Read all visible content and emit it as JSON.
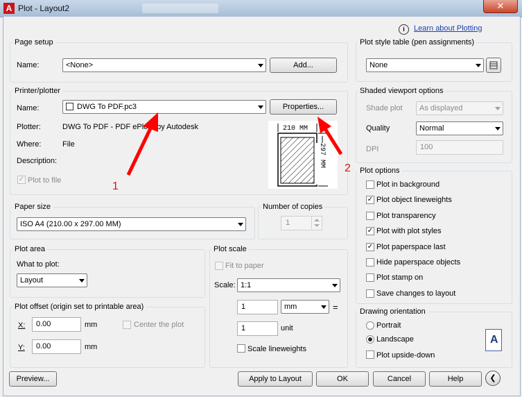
{
  "window": {
    "title": "Plot - Layout2",
    "close_glyph": "✕",
    "app_icon_letter": "A"
  },
  "help_link": {
    "label": "Learn about Plotting",
    "icon": "info-icon"
  },
  "page_setup": {
    "title": "Page setup",
    "name_label": "Name:",
    "name_value": "<None>",
    "add_button": "Add..."
  },
  "printer": {
    "title": "Printer/plotter",
    "name_label": "Name:",
    "name_value": "DWG To PDF.pc3",
    "properties_button": "Properties...",
    "plotter_label": "Plotter:",
    "plotter_value": "DWG To PDF - PDF ePlot - by Autodesk",
    "where_label": "Where:",
    "where_value": "File",
    "description_label": "Description:",
    "plot_to_file_label": "Plot to file",
    "plot_to_file_checked": true,
    "preview_width": "210 MM",
    "preview_height": "297 MM"
  },
  "annotations": {
    "arrow_1_label": "1",
    "arrow_2_label": "2",
    "arrow_color": "#ff0000"
  },
  "paper_size": {
    "title": "Paper size",
    "value": "ISO A4 (210.00 x 297.00 MM)"
  },
  "copies": {
    "title": "Number of copies",
    "value": "1"
  },
  "plot_area": {
    "title": "Plot area",
    "what_label": "What to plot:",
    "what_value": "Layout"
  },
  "plot_offset": {
    "title": "Plot offset (origin set to printable area)",
    "x_label": "X:",
    "x_value": "0.00",
    "x_unit": "mm",
    "y_label": "Y:",
    "y_value": "0.00",
    "y_unit": "mm",
    "center_label": "Center the plot"
  },
  "plot_scale": {
    "title": "Plot scale",
    "fit_label": "Fit to paper",
    "scale_label": "Scale:",
    "scale_value": "1:1",
    "value1": "1",
    "unit1": "mm",
    "equals": "=",
    "value2": "1",
    "unit2": "unit",
    "lineweights_label": "Scale lineweights"
  },
  "plot_style_table": {
    "title": "Plot style table (pen assignments)",
    "value": "None"
  },
  "shaded_viewport": {
    "title": "Shaded viewport options",
    "shade_label": "Shade plot",
    "shade_value": "As displayed",
    "quality_label": "Quality",
    "quality_value": "Normal",
    "dpi_label": "DPI",
    "dpi_value": "100"
  },
  "plot_options": {
    "title": "Plot options",
    "items": [
      {
        "label": "Plot in background",
        "checked": false
      },
      {
        "label": "Plot object lineweights",
        "checked": true
      },
      {
        "label": "Plot transparency",
        "checked": false
      },
      {
        "label": "Plot with plot styles",
        "checked": true
      },
      {
        "label": "Plot paperspace last",
        "checked": true
      },
      {
        "label": "Hide paperspace objects",
        "checked": false
      },
      {
        "label": "Plot stamp on",
        "checked": false
      },
      {
        "label": "Save changes to layout",
        "checked": false
      }
    ]
  },
  "drawing_orientation": {
    "title": "Drawing orientation",
    "portrait": "Portrait",
    "landscape": "Landscape",
    "selected": "Landscape",
    "upside_down": "Plot upside-down",
    "icon_letter": "A"
  },
  "footer": {
    "preview": "Preview...",
    "apply": "Apply to Layout",
    "ok": "OK",
    "cancel": "Cancel",
    "help": "Help",
    "collapse_glyph": "❮"
  }
}
